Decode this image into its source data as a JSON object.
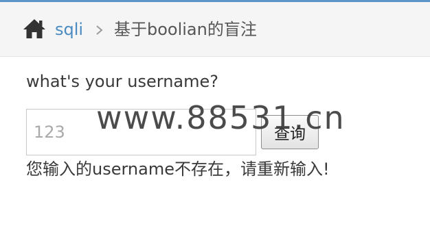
{
  "breadcrumb": {
    "home_icon": "home-icon",
    "link": "sqli",
    "separator_icon": "chevron-right-icon",
    "current": "基于boolian的盲注"
  },
  "form": {
    "question": "what's your username?",
    "input_value": "",
    "input_placeholder": "123",
    "submit_label": "查询"
  },
  "result": {
    "message": "您输入的username不存在，请重新输入!"
  },
  "watermark": "www.88531.cn",
  "colors": {
    "accent_bar": "#5b94c7",
    "link": "#4a8bc2",
    "breadcrumb_bg": "#f5f5f5"
  }
}
